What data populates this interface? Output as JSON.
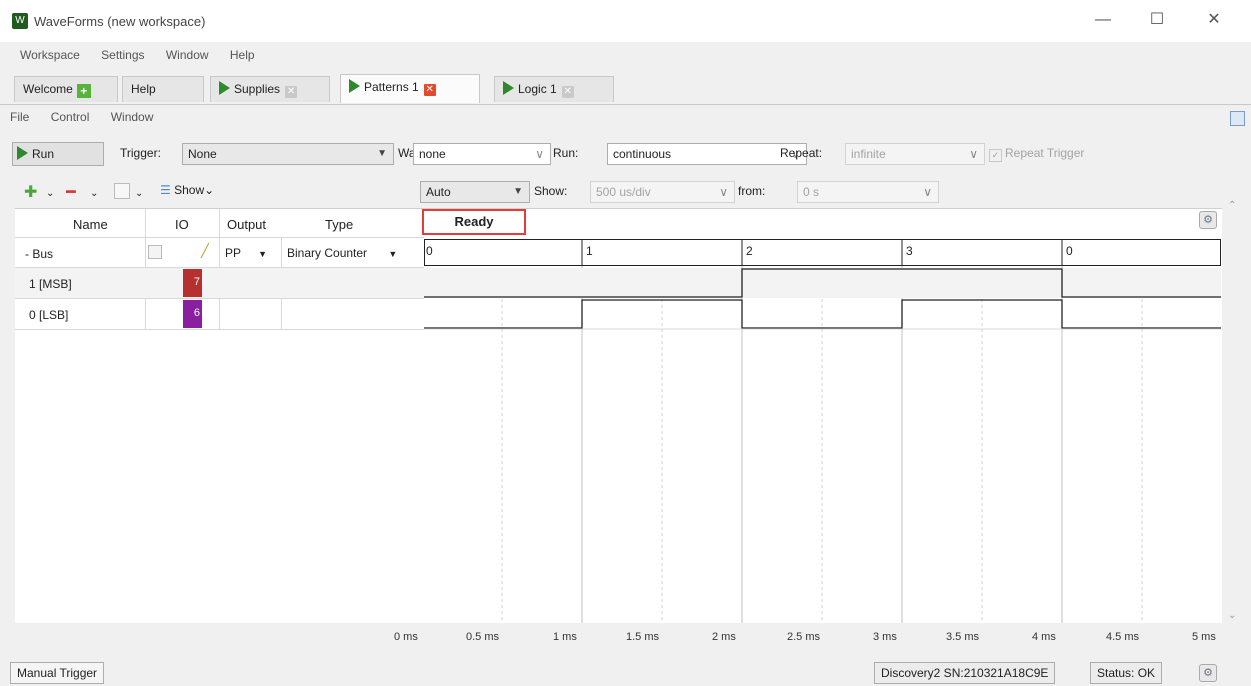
{
  "window": {
    "title": "WaveForms (new workspace)"
  },
  "main_menu": [
    "Workspace",
    "Settings",
    "Window",
    "Help"
  ],
  "tabs": [
    {
      "label": "Welcome"
    },
    {
      "label": "Help"
    },
    {
      "label": "Supplies"
    },
    {
      "label": "Patterns 1"
    },
    {
      "label": "Logic 1"
    }
  ],
  "inner_menu": [
    "File",
    "Control",
    "Window"
  ],
  "controls": {
    "run_label": "Run",
    "trigger_label": "Trigger:",
    "trigger_value": "None",
    "wait_label": "Wait:",
    "wait_value": "none",
    "run_mode_label": "Run:",
    "run_mode_value": "continuous",
    "repeat_label": "Repeat:",
    "repeat_value": "infinite",
    "repeat_trigger_label": "Repeat Trigger",
    "show_menu_label": "Show",
    "auto_value": "Auto",
    "show_label": "Show:",
    "timebase_value": "500 us/div",
    "from_label": "from:",
    "from_value": "0 s"
  },
  "table": {
    "headers": {
      "name": "Name",
      "io": "IO",
      "output": "Output",
      "type": "Type"
    },
    "rows": [
      {
        "name": "- Bus",
        "output": "PP",
        "type": "Binary Counter"
      },
      {
        "name": "1 [MSB]",
        "io": "7",
        "color": "#b5302e"
      },
      {
        "name": "0 [LSB]",
        "io": "6",
        "color": "#8a1fa0"
      }
    ]
  },
  "status": "Ready",
  "bus_values": [
    "0",
    "1",
    "2",
    "3",
    "0"
  ],
  "time_axis": [
    "0 ms",
    "0.5 ms",
    "1 ms",
    "1.5 ms",
    "2 ms",
    "2.5 ms",
    "3 ms",
    "3.5 ms",
    "4 ms",
    "4.5 ms",
    "5 ms"
  ],
  "statusbar": {
    "manual_trigger": "Manual Trigger",
    "device": "Discovery2 SN:210321A18C9E",
    "status": "Status: OK"
  }
}
